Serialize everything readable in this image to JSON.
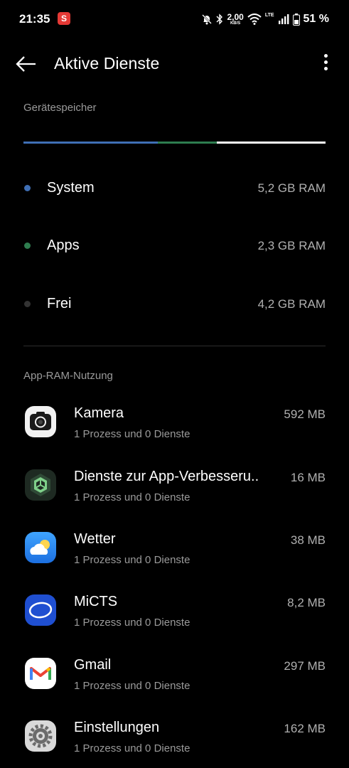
{
  "status_bar": {
    "time": "21:35",
    "net_speed_value": "2,00",
    "net_speed_unit": "KB/S",
    "lte_label": "LTE",
    "battery_percent": "51 %"
  },
  "toolbar": {
    "title": "Aktive Dienste",
    "back_icon": "arrow-left-icon",
    "more_icon": "more-vert-icon"
  },
  "storage": {
    "header": "Gerätespeicher",
    "segments": [
      {
        "name": "System",
        "fraction": 0.444,
        "color": "#3f6fb5"
      },
      {
        "name": "Apps",
        "fraction": 0.197,
        "color": "#2e7d4f"
      },
      {
        "name": "Frei",
        "fraction": 0.359,
        "color": "#ffffff"
      }
    ],
    "legend": [
      {
        "label": "System",
        "value": "5,2 GB RAM",
        "color": "#3f6fb5"
      },
      {
        "label": "Apps",
        "value": "2,3 GB RAM",
        "color": "#2e7d4f"
      },
      {
        "label": "Frei",
        "value": "4,2 GB RAM",
        "color": "#333333"
      }
    ]
  },
  "app_ram": {
    "header": "App-RAM-Nutzung",
    "apps": [
      {
        "name": "Kamera",
        "sub": "1 Prozess und 0 Dienste",
        "size": "592 MB",
        "icon": "camera-icon"
      },
      {
        "name": "Dienste zur App-Verbesseru..",
        "sub": "1 Prozess und 0 Dienste",
        "size": "16 MB",
        "icon": "app-improvement-icon"
      },
      {
        "name": "Wetter",
        "sub": "1 Prozess und 0 Dienste",
        "size": "38 MB",
        "icon": "weather-icon"
      },
      {
        "name": "MiCTS",
        "sub": "1 Prozess und 0 Dienste",
        "size": "8,2 MB",
        "icon": "micts-icon"
      },
      {
        "name": "Gmail",
        "sub": "1 Prozess und 0 Dienste",
        "size": "297 MB",
        "icon": "gmail-icon"
      },
      {
        "name": "Einstellungen",
        "sub": "1 Prozess und 0 Dienste",
        "size": "162 MB",
        "icon": "settings-gear-icon"
      }
    ]
  }
}
